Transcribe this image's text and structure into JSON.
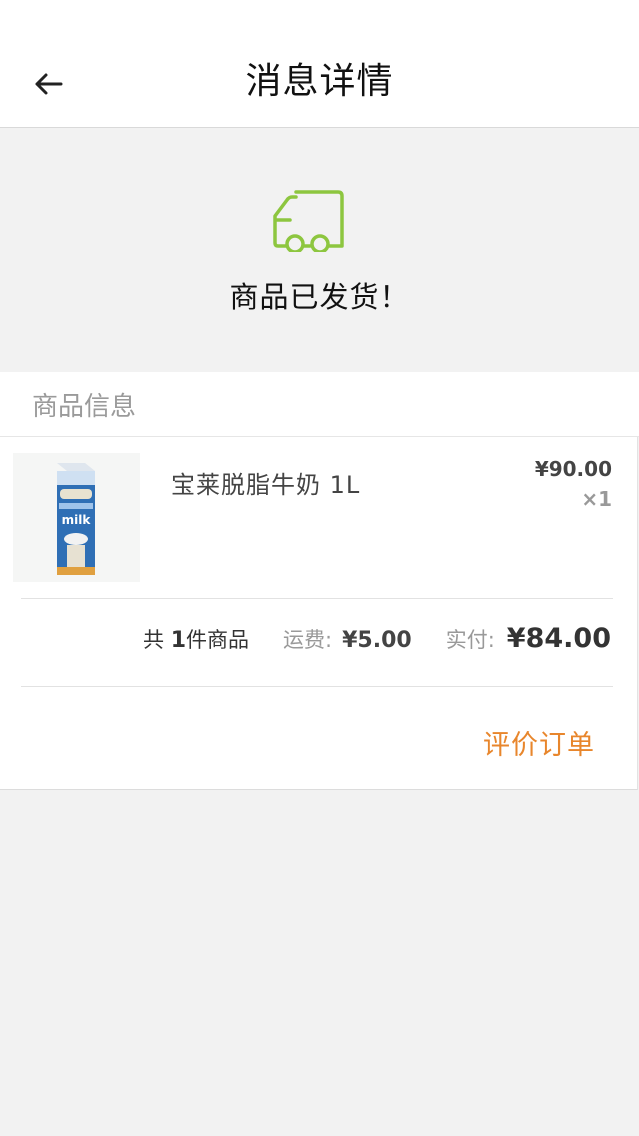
{
  "header": {
    "title": "消息详情",
    "back_icon": "arrow-left-icon"
  },
  "status": {
    "icon": "delivery-truck-icon",
    "icon_color": "#8dc63f",
    "text": "商品已发货！"
  },
  "section": {
    "title": "商品信息"
  },
  "order": {
    "item": {
      "image_icon": "milk-carton-image",
      "image_text": "milk",
      "name": "宝莱脱脂牛奶 1L",
      "price": "¥90.00",
      "quantity": "×1"
    },
    "summary": {
      "count_prefix": "共 ",
      "count_value": "1",
      "count_suffix": "件商品",
      "shipping_label": "运费:",
      "shipping_value": "¥5.00",
      "paid_label": "实付:",
      "paid_value": "¥84.00"
    },
    "review_button": "评价订单",
    "accent_color": "#e8862c"
  }
}
